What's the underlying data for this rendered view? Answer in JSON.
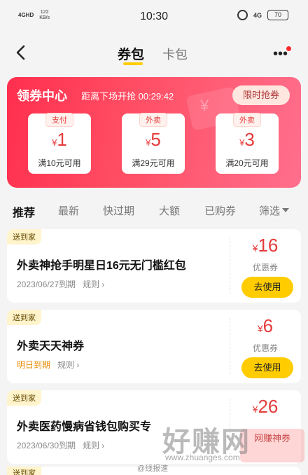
{
  "status_bar": {
    "signal": "4GHD",
    "speed": "122\nKB/s",
    "time": "10:30",
    "wifi": "4G",
    "battery": "70"
  },
  "nav": {
    "active_tab": "券包",
    "other_tab": "卡包"
  },
  "coupon_center": {
    "title": "领券中心",
    "countdown": "距离下场开抢 00:29:42",
    "button": "限时抢券",
    "coupons": [
      {
        "tag": "支付",
        "yen": "¥",
        "amount": "1",
        "condition": "满10元可用"
      },
      {
        "tag": "外卖",
        "yen": "¥",
        "amount": "5",
        "condition": "满29元可用"
      },
      {
        "tag": "外卖",
        "yen": "¥",
        "amount": "3",
        "condition": "满20元可用"
      }
    ]
  },
  "filters": [
    "推荐",
    "最新",
    "快过期",
    "大额",
    "已购券",
    "筛选"
  ],
  "coupons": [
    {
      "badge": "送到家",
      "title": "外卖神抢手明星日16元无门槛红包",
      "expiry": "2023/06/27到期",
      "rules": "规则",
      "yen": "¥",
      "amount": "16",
      "type": "优惠券",
      "button": "去使用"
    },
    {
      "badge": "送到家",
      "title": "外卖天天神券",
      "expiry": "明日到期",
      "rules": "规则",
      "yen": "¥",
      "amount": "6",
      "type": "优惠券",
      "button": "去使用"
    },
    {
      "badge": "送到家",
      "title": "外卖医药慢病省钱包购买专",
      "expiry": "2023/06/30到期",
      "rules": "规则",
      "yen": "¥",
      "amount": "26",
      "type": "",
      "button": ""
    }
  ],
  "bottom_badge": "送到家",
  "watermark": {
    "logo": "好赚网",
    "url": "www.zhuanges.com",
    "weibo": "@线报速",
    "stamp": "网赚神券"
  }
}
